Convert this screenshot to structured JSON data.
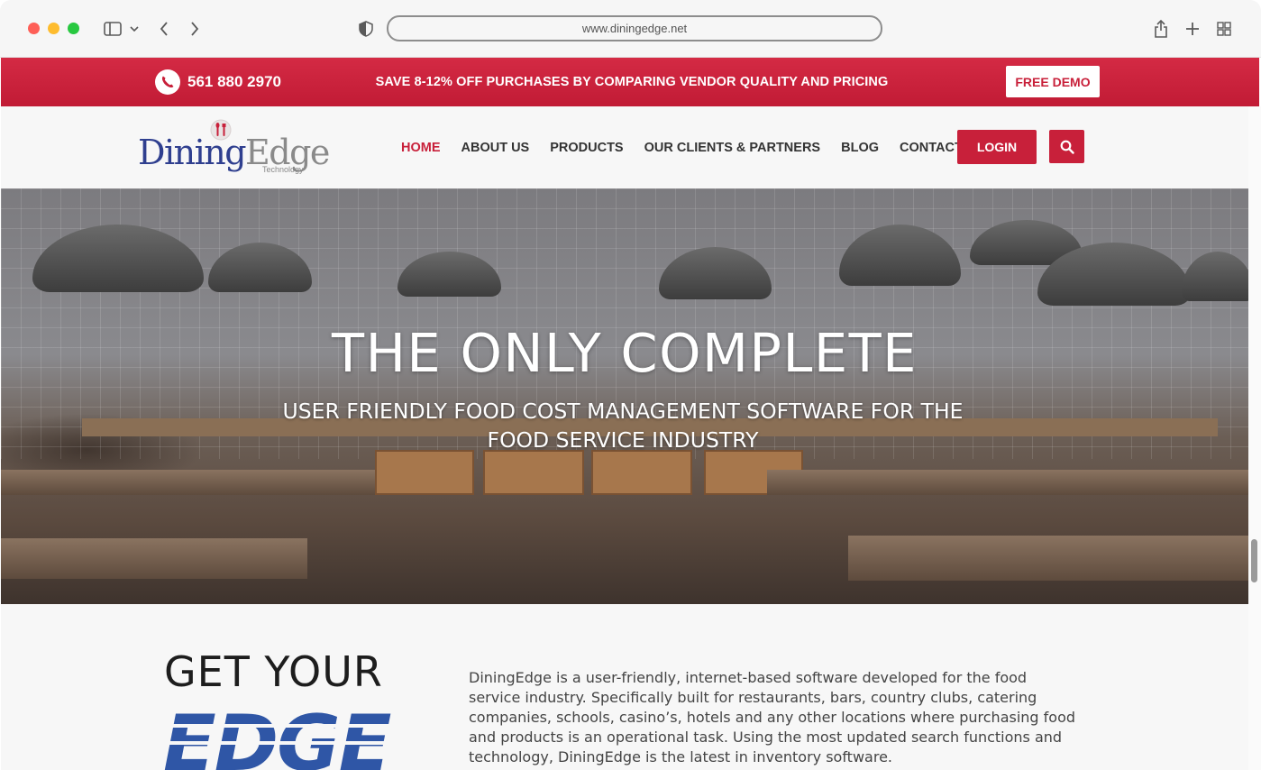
{
  "browser": {
    "url": "www.diningedge.net"
  },
  "promo": {
    "phone": "561 880 2970",
    "message": "SAVE 8-12% OFF PURCHASES BY COMPARING VENDOR QUALITY AND PRICING",
    "demo_label": "FREE DEMO"
  },
  "logo": {
    "part1": "Dining",
    "part2": "Edge",
    "tagline": "Technology"
  },
  "nav": {
    "items": [
      {
        "label": "HOME",
        "active": true
      },
      {
        "label": "ABOUT US"
      },
      {
        "label": "PRODUCTS"
      },
      {
        "label": "OUR CLIENTS & PARTNERS"
      },
      {
        "label": "BLOG"
      },
      {
        "label": "CONTACT US"
      }
    ],
    "login_label": "LOGIN"
  },
  "hero": {
    "title": "THE ONLY COMPLETE",
    "subtitle": "USER FRIENDLY FOOD COST MANAGEMENT SOFTWARE FOR THE FOOD SERVICE INDUSTRY"
  },
  "intro": {
    "heading": "GET YOUR",
    "edge_word": "EDGE",
    "body": "DiningEdge is a user-friendly, internet-based software developed for the food service industry. Specifically built for restaurants, bars, country clubs, catering companies, schools, casino’s, hotels and any other locations where purchasing food and products is an operational task. Using the most updated search functions and technology, DiningEdge is the latest in inventory software."
  },
  "colors": {
    "brand_red": "#c8203a",
    "logo_blue": "#2f3f8f",
    "edge_blue": "#2f56a6"
  },
  "icons": [
    "sidebar-icon",
    "chevron-down-icon",
    "back-icon",
    "forward-icon",
    "shield-icon",
    "share-icon",
    "new-tab-icon",
    "tab-overview-icon",
    "phone-icon",
    "search-icon",
    "utensils-icon"
  ]
}
